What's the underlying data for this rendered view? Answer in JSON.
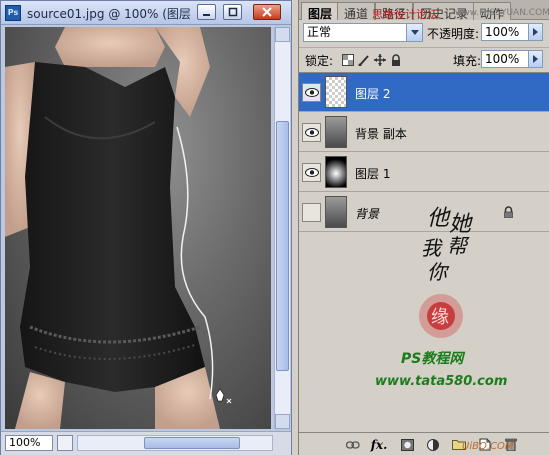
{
  "document": {
    "title": "source01.jpg @ 100% (图层",
    "zoom": "100%",
    "app_icon_text": "Ps"
  },
  "layers_panel": {
    "tabs": [
      "图层",
      "通道",
      "路径",
      "历史记录",
      "动作"
    ],
    "blend_mode": "正常",
    "opacity_label": "不透明度:",
    "opacity_value": "100%",
    "lock_label": "锁定:",
    "fill_label": "填充:",
    "fill_value": "100%",
    "layers": [
      {
        "name": "图层 2",
        "visible": true,
        "selected": true,
        "thumb": "transparent"
      },
      {
        "name": "背景 副本",
        "visible": true,
        "selected": false,
        "thumb": "photo"
      },
      {
        "name": "图层 1",
        "visible": true,
        "selected": false,
        "thumb": "glow"
      },
      {
        "name": "背景",
        "visible": false,
        "selected": false,
        "thumb": "photo",
        "locked": true
      }
    ]
  },
  "watermarks": {
    "top": "思缘设计论坛",
    "top_url": "www.MISSYUAN.COM",
    "calligraphy": [
      "他",
      "她",
      "我",
      "帮",
      "你"
    ],
    "seal": "缘",
    "site_name": "PS教程网",
    "site_url": "www.tata580.com",
    "bottom": "UiBQ.COM"
  },
  "colors": {
    "selected_layer": "#316ac5",
    "watermark_red": "#b21d1d"
  }
}
